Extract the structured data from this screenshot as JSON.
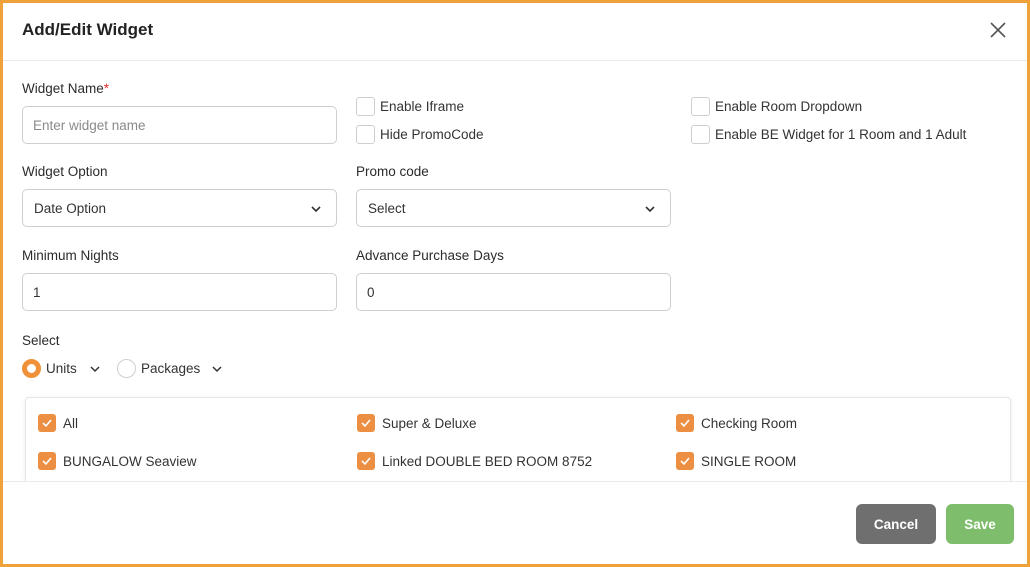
{
  "dialog": {
    "title": "Add/Edit Widget",
    "close_icon": "close-icon"
  },
  "form": {
    "widget_name": {
      "label": "Widget Name",
      "required_mark": "*",
      "value": "",
      "placeholder": "Enter widget name"
    },
    "widget_option": {
      "label": "Widget Option",
      "selected": "Date Option"
    },
    "promo_code": {
      "label": "Promo code",
      "selected": "Select"
    },
    "minimum_nights": {
      "label": "Minimum Nights",
      "value": "1"
    },
    "advance_purchase_days": {
      "label": "Advance Purchase Days",
      "value": "0"
    }
  },
  "checkboxes": {
    "enable_iframe": {
      "label": "Enable Iframe",
      "checked": false
    },
    "hide_promocode": {
      "label": "Hide PromoCode",
      "checked": false
    },
    "enable_room_dropdown": {
      "label": "Enable Room Dropdown",
      "checked": false
    },
    "enable_be_widget": {
      "label": "Enable BE Widget for 1 Room and 1 Adult",
      "checked": false
    }
  },
  "select_section": {
    "label": "Select",
    "options": [
      {
        "label": "Units",
        "selected": true
      },
      {
        "label": "Packages",
        "selected": false
      }
    ]
  },
  "units": [
    {
      "label": "All",
      "checked": true
    },
    {
      "label": "Super & Deluxe",
      "checked": true
    },
    {
      "label": "Checking Room",
      "checked": true
    },
    {
      "label": "BUNGALOW Seaview",
      "checked": true
    },
    {
      "label": "Linked DOUBLE BED ROOM 8752",
      "checked": true
    },
    {
      "label": "SINGLE ROOM",
      "checked": true
    }
  ],
  "footer": {
    "cancel_label": "Cancel",
    "save_label": "Save"
  },
  "colors": {
    "accent": "#ec8f42",
    "border_frame": "#f0a23a",
    "cancel": "#6f6f6f",
    "save": "#7dbd6b"
  }
}
